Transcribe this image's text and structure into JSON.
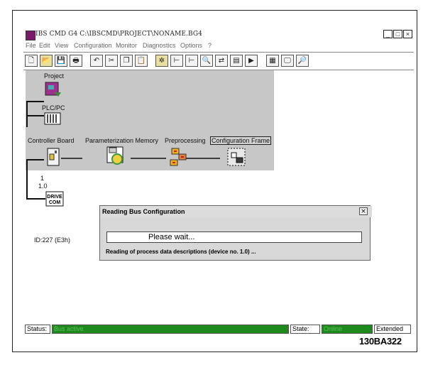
{
  "window": {
    "title": "IBS CMD G4 C:\\IBSCMD\\PROJECT\\NONAME.BG4",
    "minimize": "_",
    "maximize": "□",
    "close": "×"
  },
  "menu": {
    "file": "File",
    "edit": "Edit",
    "view": "View",
    "configuration": "Configuration",
    "monitor": "Monitor",
    "diagnostics": "Diagnostics",
    "options": "Options",
    "help": "?"
  },
  "toolbar": {
    "buttons": [
      {
        "name": "new-icon",
        "glyph": "🗋"
      },
      {
        "name": "open-icon",
        "glyph": "📂"
      },
      {
        "name": "save-icon",
        "glyph": "💾"
      },
      {
        "name": "print-icon",
        "glyph": "🖶"
      },
      {
        "name": "undo-icon",
        "glyph": "↶"
      },
      {
        "name": "cut-icon",
        "glyph": "✂"
      },
      {
        "name": "copy-icon",
        "glyph": "❐"
      },
      {
        "name": "paste-icon",
        "glyph": "📋"
      },
      {
        "name": "settings-icon",
        "glyph": "✲"
      },
      {
        "name": "insert-after-icon",
        "glyph": "⊢"
      },
      {
        "name": "insert-below-icon",
        "glyph": "⊢"
      },
      {
        "name": "find-icon",
        "glyph": "🔍"
      },
      {
        "name": "bus-config-icon",
        "glyph": "⇄"
      },
      {
        "name": "add-device-icon",
        "glyph": "▤"
      },
      {
        "name": "compare-icon",
        "glyph": "▶"
      },
      {
        "name": "diagnostics-icon",
        "glyph": "▦"
      },
      {
        "name": "monitor-icon",
        "glyph": "🖵"
      },
      {
        "name": "search-device-icon",
        "glyph": "🔎"
      }
    ]
  },
  "tree": {
    "project": "Project",
    "plcpc": "PLC/PC",
    "controller_board": "Controller Board",
    "param_memory": "Parameterization Memory",
    "preprocessing": "Preprocessing",
    "config_frame": "Configuration Frame",
    "segment": "1",
    "device_no": "1.0",
    "device_id": "ID:227 (E3h)"
  },
  "dialog": {
    "title": "Reading Bus Configuration",
    "close": "×",
    "progress_text": "Please wait...",
    "message": "Reading of process data descriptions (device no. 1.0) ..."
  },
  "statusbar": {
    "status_label": "Status:",
    "status_value": "Bus active",
    "state_label": "State:",
    "state_value": "Online",
    "mode": "Extended"
  },
  "reference": "130BA322"
}
